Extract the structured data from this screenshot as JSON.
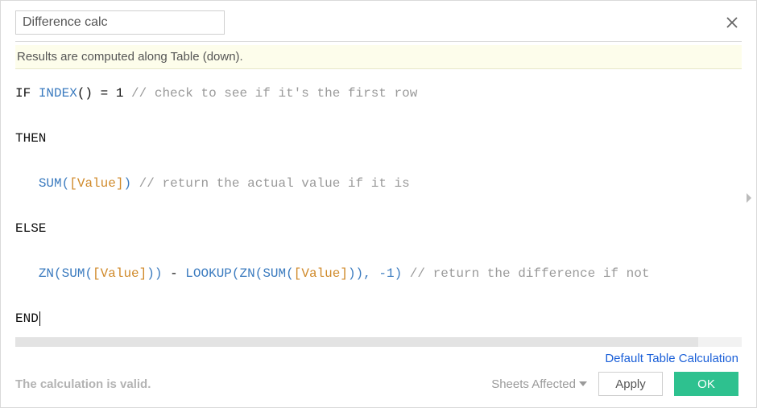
{
  "calc_name": "Difference calc",
  "info_text": "Results are computed along Table (down).",
  "formula": {
    "line1": {
      "kw": "IF",
      "fn": "INDEX",
      "after_fn": "() = 1",
      "comment": "// check to see if it's the first row"
    },
    "line2": {
      "kw": "THEN"
    },
    "line3": {
      "indent": "   ",
      "agg": "SUM",
      "open": "(",
      "field": "[Value]",
      "close": ")",
      "comment": "// return the actual value if it is"
    },
    "line4": {
      "kw": "ELSE"
    },
    "line5": {
      "indent": "   ",
      "fn1": "ZN",
      "p1": "(",
      "agg1": "SUM",
      "p2": "(",
      "fld1": "[Value]",
      "p3": "))",
      "minus": " - ",
      "fn2": "LOOKUP",
      "p4": "(",
      "fn3": "ZN",
      "p5": "(",
      "agg2": "SUM",
      "p6": "(",
      "fld2": "[Value]",
      "p7": ")), -1)",
      "comment": "// return the difference if not"
    },
    "line6": {
      "kw": "END"
    }
  },
  "link_text": "Default Table Calculation",
  "status_text": "The calculation is valid.",
  "sheets_affected_label": "Sheets Affected",
  "apply_label": "Apply",
  "ok_label": "OK"
}
